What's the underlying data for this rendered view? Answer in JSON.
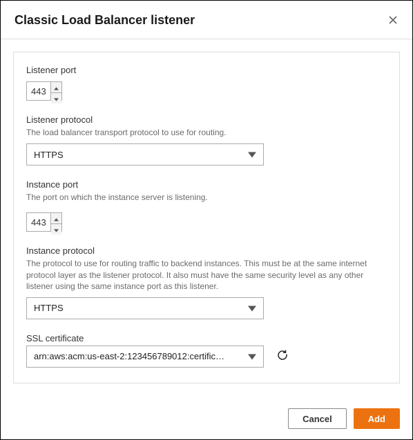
{
  "dialog": {
    "title": "Classic Load Balancer listener"
  },
  "fields": {
    "listenerPort": {
      "label": "Listener port",
      "value": "443"
    },
    "listenerProtocol": {
      "label": "Listener protocol",
      "help": "The load balancer transport protocol to use for routing.",
      "value": "HTTPS"
    },
    "instancePort": {
      "label": "Instance port",
      "help": "The port on which the instance server is listening.",
      "value": "443"
    },
    "instanceProtocol": {
      "label": "Instance protocol",
      "help": "The protocol to use for routing traffic to backend instances. This must be at the same internet protocol layer as the listener protocol. It also must have the same security level as any other listener using the same instance port as this listener.",
      "value": "HTTPS"
    },
    "sslCertificate": {
      "label": "SSL certificate",
      "value": "arn:aws:acm:us-east-2:123456789012:certific…"
    }
  },
  "buttons": {
    "cancel": "Cancel",
    "add": "Add"
  }
}
